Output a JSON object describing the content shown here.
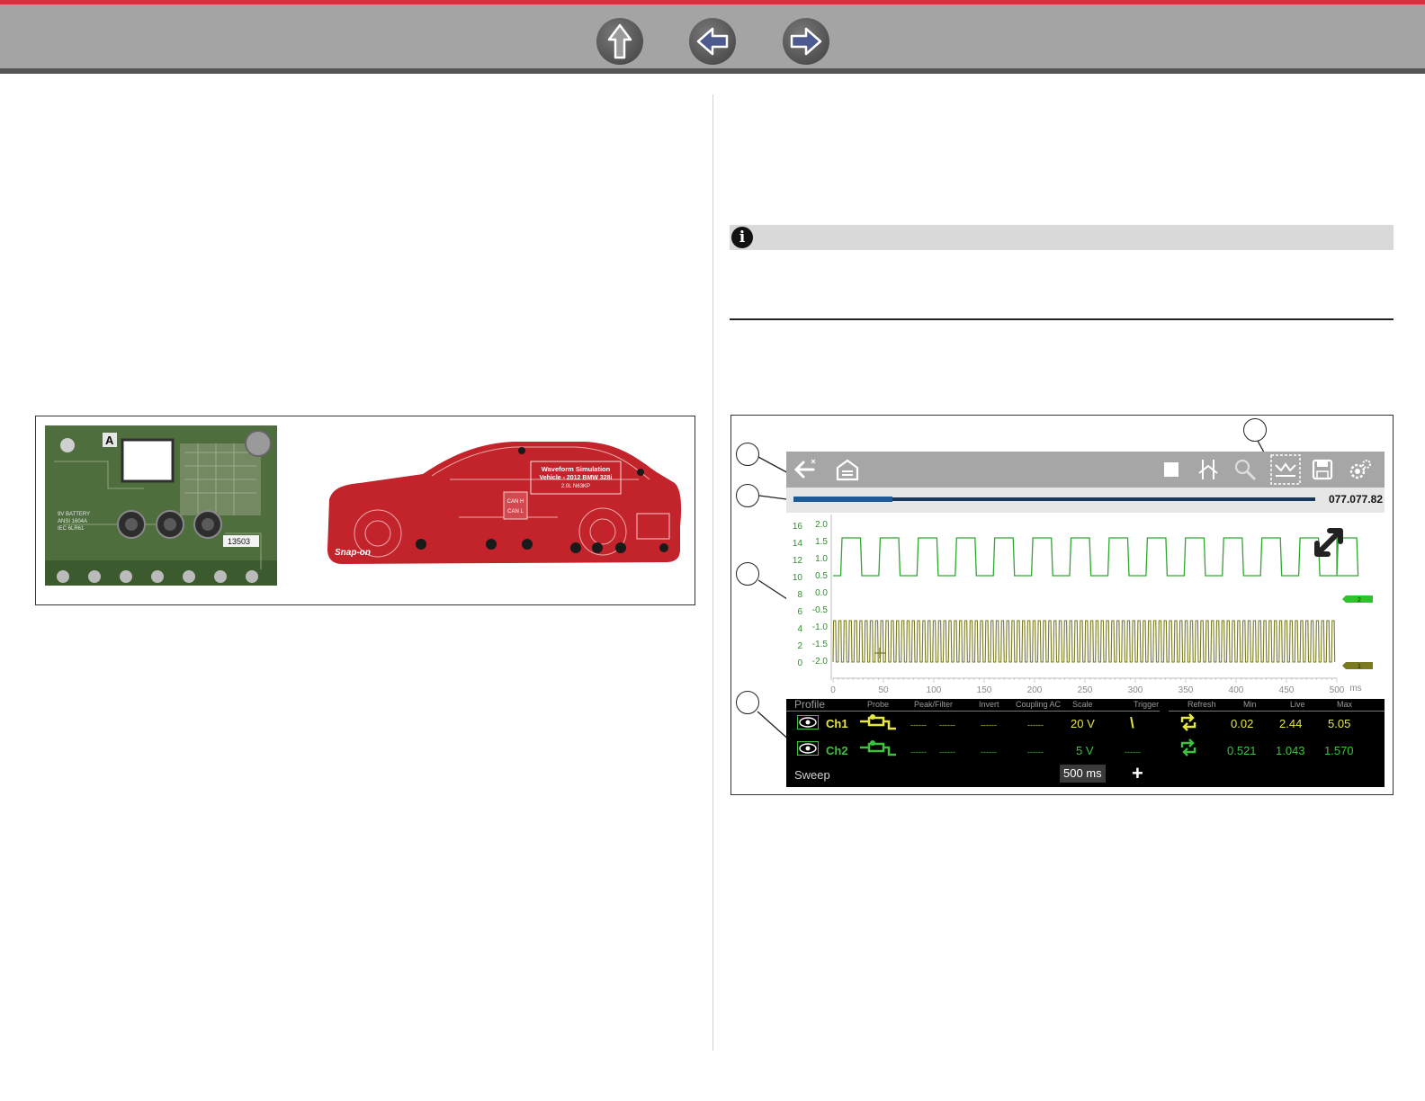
{
  "nav": {
    "buttons": [
      {
        "name": "up-arrow-icon"
      },
      {
        "name": "back-arrow-icon"
      },
      {
        "name": "forward-arrow-icon"
      }
    ]
  },
  "board": {
    "label_a": "A",
    "battery_text": "9V BATTERY\nANSI 1604A\nIEC 6LR61",
    "serial": "13503"
  },
  "car": {
    "title_line1": "Waveform Simulation",
    "title_line2": "Vehicle - 2012 BMW 328i",
    "title_line3": "2.0L N63KP",
    "can_h": "CAN H",
    "can_l": "CAN L",
    "brand": "Snap-on"
  },
  "scope": {
    "time_readout": "077.077.82",
    "progress_fraction": 0.19,
    "y_left": [
      "16",
      "14",
      "12",
      "10",
      "8",
      "6",
      "4",
      "2",
      "0"
    ],
    "y_right": [
      "2.0",
      "1.5",
      "1.0",
      "0.5",
      "0.0",
      "-0.5",
      "-1.0",
      "-1.5",
      "-2.0"
    ],
    "x_ticks": [
      "0",
      "50",
      "100",
      "150",
      "200",
      "250",
      "300",
      "350",
      "400",
      "450",
      "500"
    ],
    "x_unit": "ms",
    "ch2_marker": "2",
    "ch1_marker": "1",
    "table": {
      "headers": [
        "Profile",
        "Probe",
        "Peak/Filter",
        "Invert",
        "Coupling AC",
        "Scale",
        "Trigger",
        "Refresh",
        "Min",
        "Live",
        "Max"
      ],
      "ch1": {
        "label": "Ch1",
        "dash": "------",
        "scale": "20 V",
        "trigger": "\\",
        "min": "0.02",
        "live": "2.44",
        "max": "5.05"
      },
      "ch2": {
        "label": "Ch2",
        "dash": "------",
        "scale": "5 V",
        "trigger": "------",
        "min": "0.521",
        "live": "1.043",
        "max": "1.570"
      },
      "sweep_label": "Sweep",
      "sweep_value": "500 ms",
      "plus": "+"
    }
  },
  "colors": {
    "accent_red": "#d6303b",
    "ch1_color": "#e8e83a",
    "ch2_color": "#3cc23c",
    "trace_green": "#2fa82f",
    "trace_olive": "#7a7a20"
  }
}
